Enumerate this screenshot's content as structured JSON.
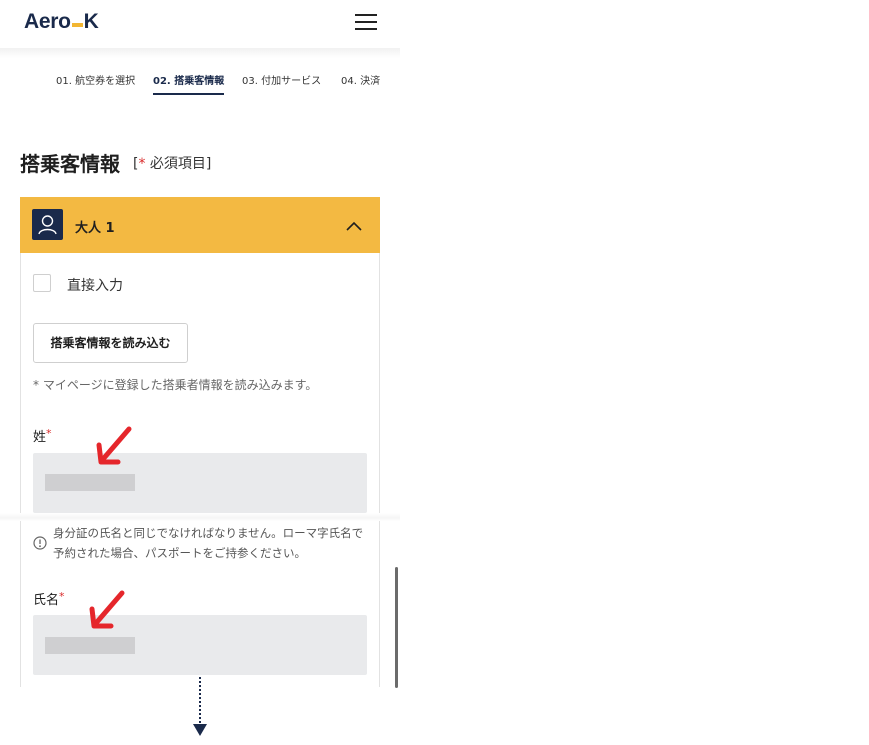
{
  "header": {
    "logo_left": "Aero",
    "logo_right": "K",
    "menu_icon": "hamburger-menu-icon"
  },
  "steps": [
    {
      "label": "01. 航空券を選択",
      "active": false
    },
    {
      "label": "02. 搭乗客情報",
      "active": true
    },
    {
      "label": "03. 付加サービス",
      "active": false
    },
    {
      "label": "04. 決済",
      "active": false
    }
  ],
  "section": {
    "title": "搭乗客情報",
    "required_open": "[",
    "required_star": "*",
    "required_text": " 必須項目]"
  },
  "passenger_card": {
    "title": "大人 1",
    "avatar_icon": "user-icon",
    "collapse_icon": "chevron-up-icon",
    "header_color": "#f3b942"
  },
  "direct_input": {
    "label": "直接入力",
    "checked": false
  },
  "load_button": {
    "label": "搭乗客情報を読み込む"
  },
  "load_hint": "* マイページに登録した搭乗者情報を読み込みます。",
  "fields": {
    "surname": {
      "label": "姓",
      "required_star": "*"
    },
    "name": {
      "label": "氏名",
      "required_star": "*"
    }
  },
  "info_note": "身分証の氏名と同じでなければなりません。ローマ字氏名で予約された場合、パスポートをご持参ください。",
  "colors": {
    "brand_navy": "#1a2a4b",
    "brand_yellow": "#f3b942",
    "required_red": "#d92b2b",
    "annotation_red": "#e5262b"
  }
}
